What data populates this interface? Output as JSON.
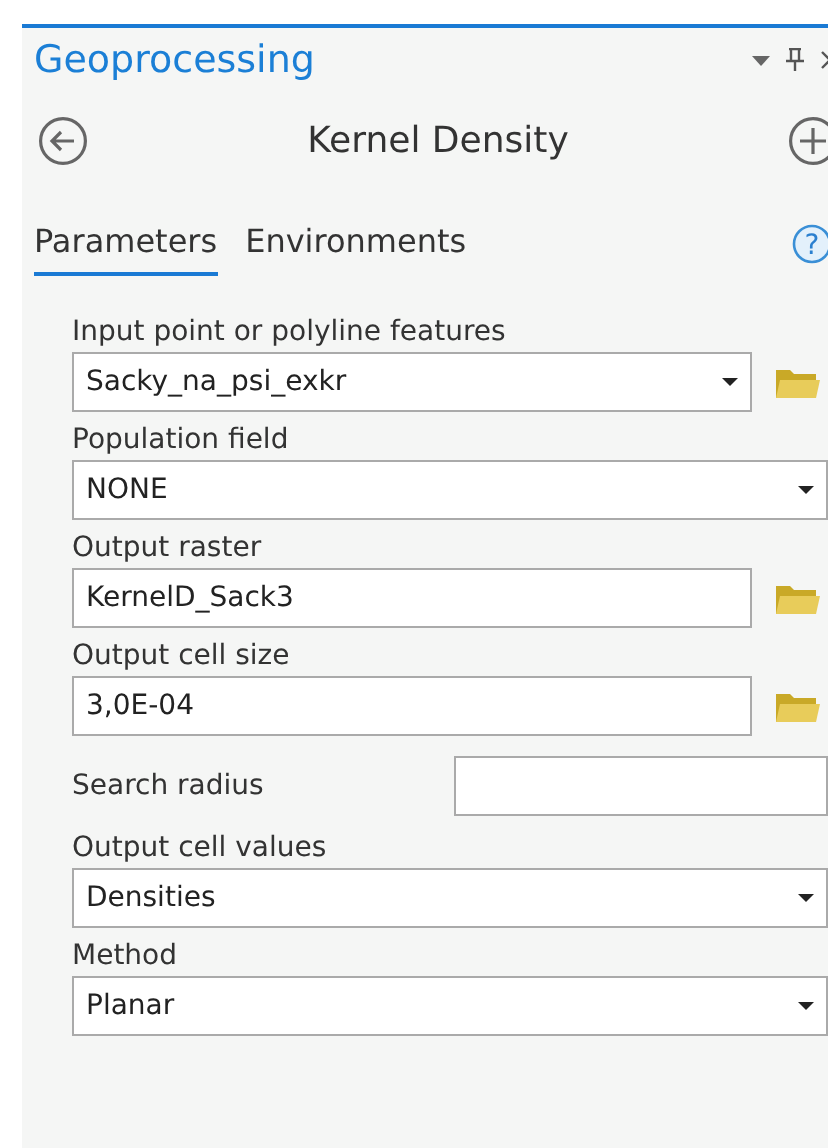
{
  "pane": {
    "title": "Geoprocessing"
  },
  "tool": {
    "title": "Kernel Density"
  },
  "tabs": [
    {
      "label": "Parameters",
      "selected": true
    },
    {
      "label": "Environments",
      "selected": false
    }
  ],
  "help": {
    "glyph": "?"
  },
  "parameters": [
    {
      "kind": "dropdown",
      "label": "Input point or polyline features",
      "value": "Sacky_na_psi_exkr",
      "browse": true
    },
    {
      "kind": "dropdown",
      "label": "Population field",
      "value": "NONE",
      "browse": false
    },
    {
      "kind": "text",
      "label": "Output raster",
      "value": "KernelD_Sack3",
      "browse": true
    },
    {
      "kind": "text",
      "label": "Output cell size",
      "value": "3,0E-04",
      "browse": true
    },
    {
      "kind": "inline",
      "label": "Search radius",
      "browse": false
    },
    {
      "kind": "dropdown",
      "label": "Output cell values",
      "value": "Densities",
      "browse": false
    },
    {
      "kind": "dropdown",
      "label": "Method",
      "value": "Planar",
      "browse": false
    }
  ]
}
